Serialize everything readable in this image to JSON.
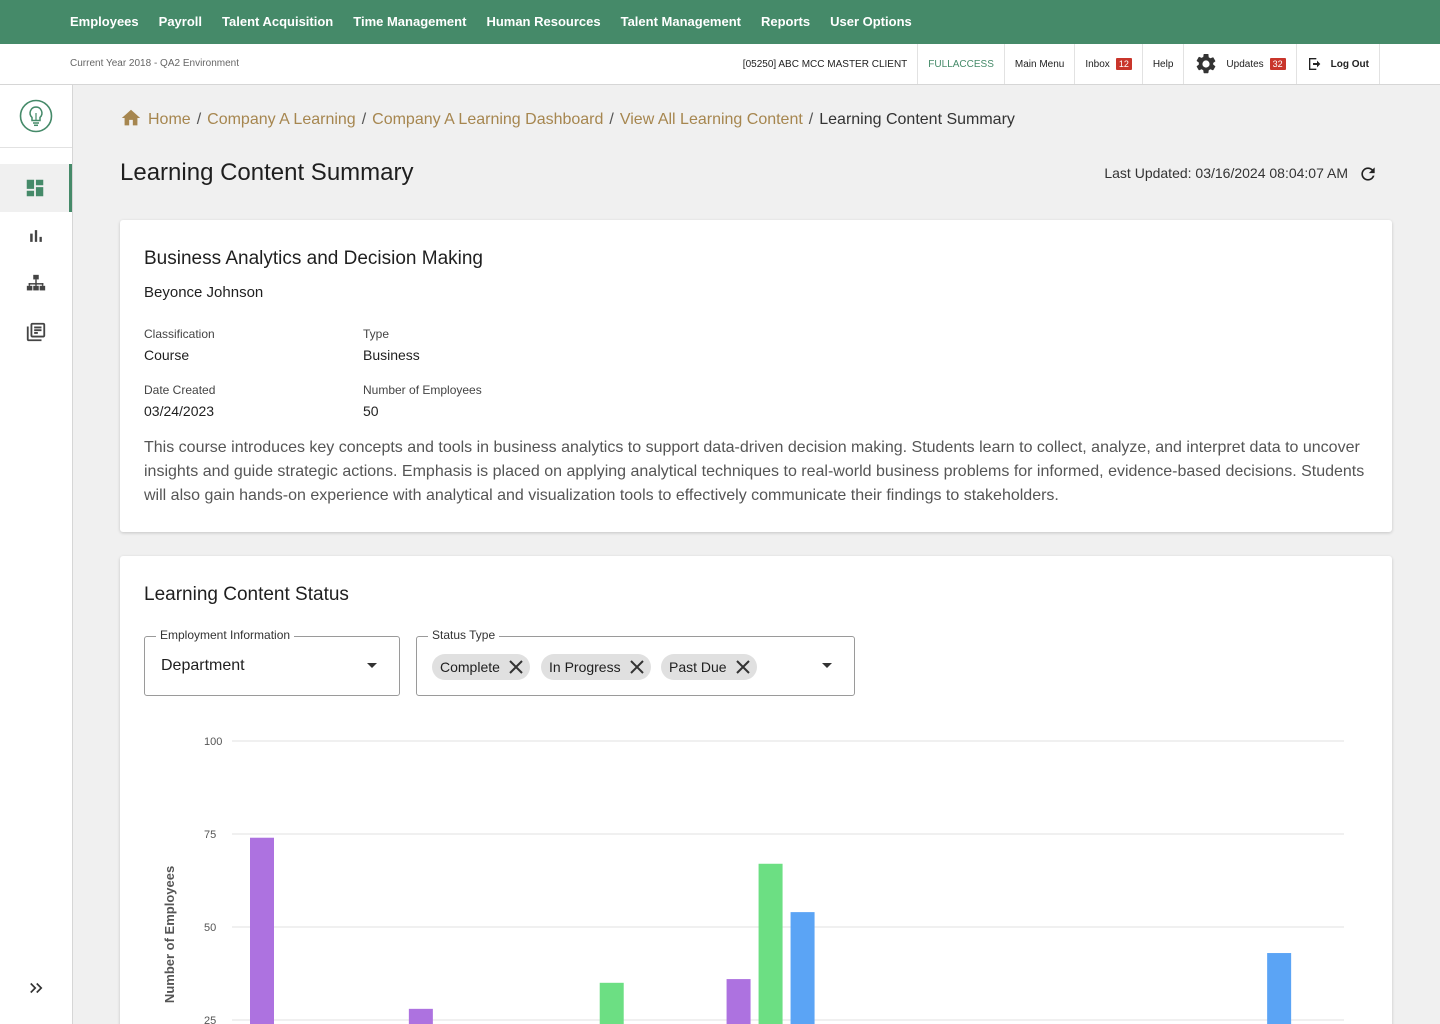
{
  "topnav": [
    "Employees",
    "Payroll",
    "Talent Acquisition",
    "Time Management",
    "Human Resources",
    "Talent Management",
    "Reports",
    "User Options"
  ],
  "subheader": {
    "environment": "Current Year 2018 - QA2 Environment",
    "client": "[05250] ABC MCC MASTER CLIENT",
    "access": "FULLACCESS",
    "main_menu": "Main Menu",
    "inbox": "Inbox",
    "inbox_count": "12",
    "help": "Help",
    "updates": "Updates",
    "updates_count": "32",
    "logout": "Log Out"
  },
  "sidebar": {
    "icons": [
      "lightbulb-logo-icon",
      "dashboard-icon",
      "bar-chart-icon",
      "org-chart-icon",
      "library-icon",
      "expand-icon"
    ]
  },
  "breadcrumb": {
    "home": "Home",
    "items": [
      "Company A Learning",
      "Company A Learning Dashboard",
      "View All Learning Content"
    ],
    "current": "Learning Content Summary",
    "separator": "/"
  },
  "page": {
    "title": "Learning Content Summary",
    "last_updated": "Last Updated: 03/16/2024 08:04:07 AM"
  },
  "summary": {
    "title": "Business Analytics and Decision Making",
    "author": "Beyonce Johnson",
    "classification_label": "Classification",
    "classification": "Course",
    "type_label": "Type",
    "type": "Business",
    "date_label": "Date Created",
    "date": "03/24/2023",
    "employees_label": "Number of Employees",
    "employees": "50",
    "description": "This course introduces key concepts and tools in business analytics to support data-driven decision making. Students learn to collect, analyze, and interpret data to uncover insights and guide strategic actions. Emphasis is placed on applying analytical techniques to real-world business problems for informed, evidence-based decisions. Students will also gain hands-on experience with analytical and visualization tools to effectively communicate their findings to stakeholders."
  },
  "status": {
    "title": "Learning Content Status",
    "employment_label": "Employment Information",
    "employment_value": "Department",
    "status_label": "Status Type",
    "chips": [
      "Complete",
      "In Progress",
      "Past Due"
    ]
  },
  "colors": {
    "brand_green": "#458a69",
    "link_gold": "#a6864f",
    "badge_red": "#c9352b",
    "series_purple": "#ad72e0",
    "series_green": "#6cdf83",
    "series_blue": "#5ba4f5"
  },
  "chart_data": {
    "type": "bar",
    "ylabel": "Number of Employees",
    "xlabel": "",
    "ylim": [
      0,
      100
    ],
    "yticks": [
      25,
      50,
      75,
      100
    ],
    "grid": true,
    "groups": 7,
    "bars": [
      {
        "group": 0,
        "slot": 0,
        "value": 74,
        "color": "#ad72e0"
      },
      {
        "group": 1,
        "slot": 0,
        "value": 28,
        "color": "#ad72e0"
      },
      {
        "group": 2,
        "slot": 1,
        "value": 35,
        "color": "#6cdf83"
      },
      {
        "group": 3,
        "slot": 0,
        "value": 36,
        "color": "#ad72e0"
      },
      {
        "group": 3,
        "slot": 1,
        "value": 67,
        "color": "#6cdf83"
      },
      {
        "group": 3,
        "slot": 2,
        "value": 54,
        "color": "#5ba4f5"
      },
      {
        "group": 6,
        "slot": 2,
        "value": 43,
        "color": "#5ba4f5"
      }
    ]
  }
}
